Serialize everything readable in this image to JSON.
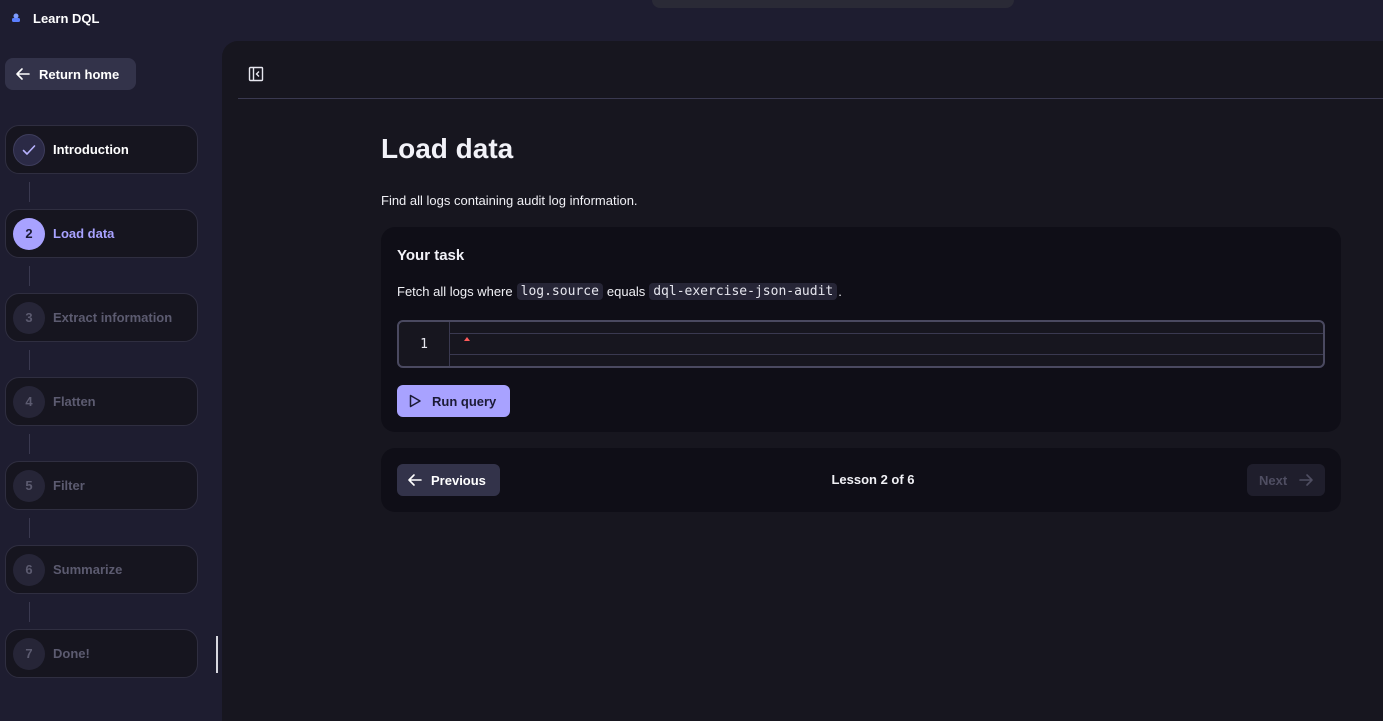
{
  "app": {
    "title": "Learn DQL"
  },
  "sidebar": {
    "return_label": "Return home",
    "steps": [
      {
        "number": "1",
        "label": "Introduction",
        "state": "done"
      },
      {
        "number": "2",
        "label": "Load data",
        "state": "active"
      },
      {
        "number": "3",
        "label": "Extract information",
        "state": "todo"
      },
      {
        "number": "4",
        "label": "Flatten",
        "state": "todo"
      },
      {
        "number": "5",
        "label": "Filter",
        "state": "todo"
      },
      {
        "number": "6",
        "label": "Summarize",
        "state": "todo"
      },
      {
        "number": "7",
        "label": "Done!",
        "state": "todo"
      }
    ]
  },
  "lesson": {
    "title": "Load data",
    "description": "Find all logs containing audit log information."
  },
  "task": {
    "heading": "Your task",
    "text_before": "Fetch all logs where",
    "code_field": "log.source",
    "text_middle": "equals",
    "code_value": "dql-exercise-json-audit",
    "text_after": ".",
    "editor_line_number": "1",
    "editor_value": "",
    "run_label": "Run query"
  },
  "navigation": {
    "previous_label": "Previous",
    "counter": "Lesson 2 of 6",
    "next_label": "Next"
  },
  "colors": {
    "accent": "#a8a2ff",
    "background": "#1e1d30",
    "panel": "#17161f",
    "card": "#0f0e17"
  },
  "icons": {
    "logo": "dql-logo-icon",
    "back": "arrow-left-icon",
    "check": "check-icon",
    "collapse": "sidebar-collapse-icon",
    "play": "play-icon",
    "forward": "arrow-right-icon"
  }
}
